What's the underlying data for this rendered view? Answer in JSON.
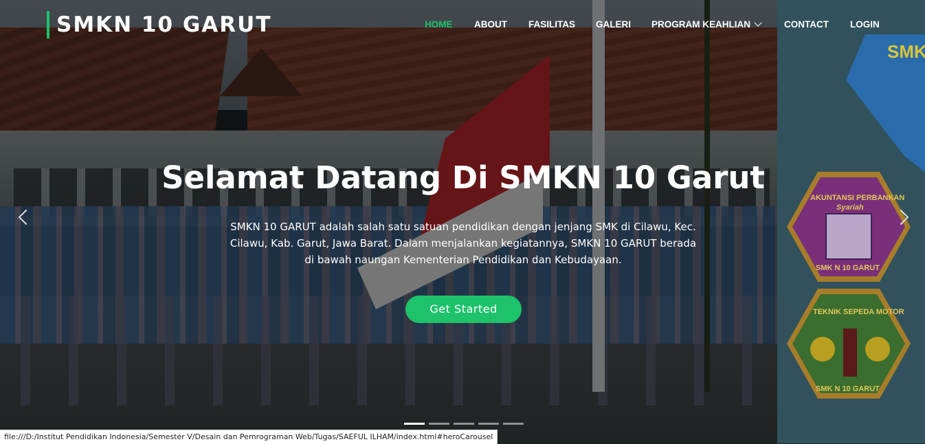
{
  "brand": "SMKN 10 GARUT",
  "nav": {
    "home": "HOME",
    "about": "ABOUT",
    "fasilitas": "FASILITAS",
    "galeri": "GALERI",
    "program": "PROGRAM KEAHLIAN",
    "contact": "CONTACT",
    "login": "LOGIN"
  },
  "hero": {
    "title": "Selamat Datang Di SMKN 10 Garut",
    "line1": "SMKN 10 GARUT adalah salah satu satuan pendidikan dengan jenjang SMK di Cilawu, Kec.",
    "line2": "Cilawu, Kab. Garut, Jawa Barat. Dalam menjalankan kegiatannya, SMKN 10 GARUT berada",
    "line3": "di bawah naungan Kementerian Pendidikan dan Kebudayaan.",
    "cta": "Get Started"
  },
  "badges": {
    "logo_text": "SMK",
    "badge1_top": "AKUNTANSI PERBANKAN",
    "badge1_sub": "Syariah",
    "badge1_bottom": "SMK N 10 GARUT",
    "badge2_top": "TEKNIK SEPEDA MOTOR",
    "badge2_bottom": "SMK N 10 GARUT"
  },
  "carousel": {
    "slides": 5,
    "active": 1
  },
  "status_url": "file:///D:/Institut Pendidikan Indonesia/Semester V/Desain dan Pemrograman Web/Tugas/SAEFUL ILHAM/index.html#heroCarousel",
  "colors": {
    "accent": "#1ec26a",
    "overlay": "rgba(0,0,0,0.45)"
  }
}
